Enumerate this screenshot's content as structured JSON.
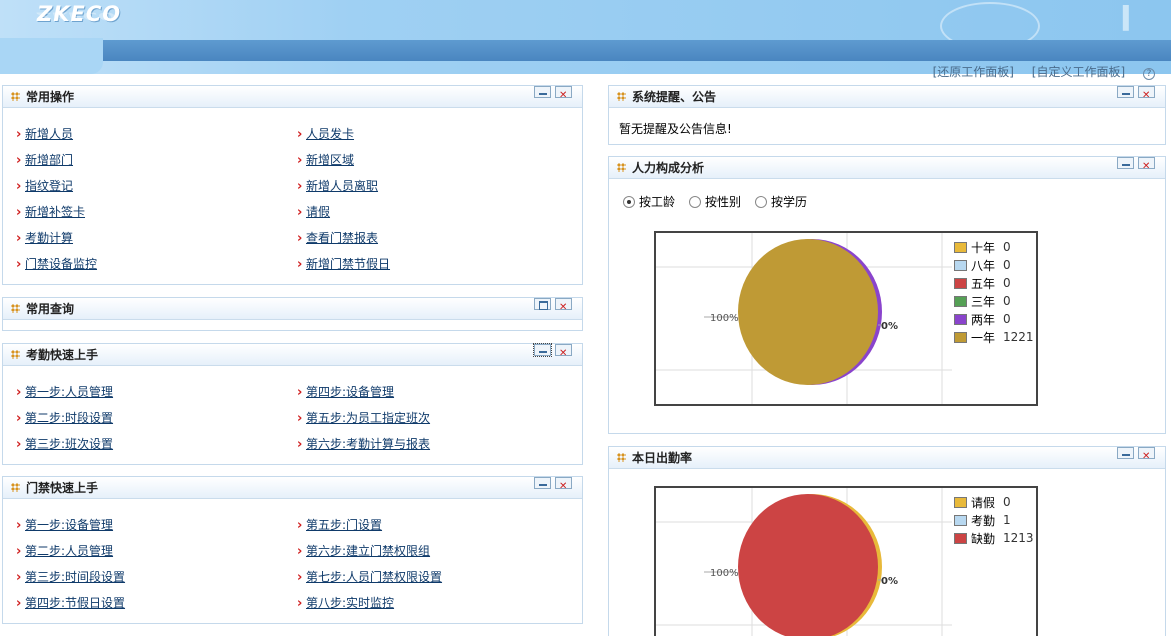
{
  "header": {
    "logo": "ZKECO",
    "restore_label": "[还原工作面板]",
    "customize_label": "[自定义工作面板]",
    "help": "?"
  },
  "common_ops": {
    "title": "常用操作",
    "left": [
      "新增人员",
      "新增部门",
      "指纹登记",
      "新增补签卡",
      "考勤计算",
      "门禁设备监控"
    ],
    "right": [
      "人员发卡",
      "新增区域",
      "新增人员离职",
      "请假",
      "查看门禁报表",
      "新增门禁节假日"
    ]
  },
  "common_query": {
    "title": "常用查询"
  },
  "att_quick": {
    "title": "考勤快速上手",
    "left": [
      "第一步:人员管理",
      "第二步:时段设置",
      "第三步:班次设置"
    ],
    "right": [
      "第四步:设备管理",
      "第五步:为员工指定班次",
      "第六步:考勤计算与报表"
    ]
  },
  "acc_quick": {
    "title": "门禁快速上手",
    "left": [
      "第一步:设备管理",
      "第二步:人员管理",
      "第三步:时间段设置",
      "第四步:节假日设置"
    ],
    "right": [
      "第五步:门设置",
      "第六步:建立门禁权限组",
      "第七步:人员门禁权限设置",
      "第八步:实时监控"
    ]
  },
  "notice": {
    "title": "系统提醒、公告",
    "text": "暂无提醒及公告信息!"
  },
  "hr": {
    "title": "人力构成分析",
    "radios": [
      "按工龄",
      "按性别",
      "按学历"
    ],
    "selected": 0
  },
  "attendance": {
    "title": "本日出勤率"
  },
  "chart_data": [
    {
      "type": "pie",
      "title": "",
      "series": [
        {
          "name": "十年",
          "value": 0,
          "color": "#e8b93a"
        },
        {
          "name": "八年",
          "value": 0,
          "color": "#b8d8f0"
        },
        {
          "name": "五年",
          "value": 0,
          "color": "#cc4444"
        },
        {
          "name": "三年",
          "value": 0,
          "color": "#55a055"
        },
        {
          "name": "两年",
          "value": 0,
          "color": "#8a44cc"
        },
        {
          "name": "一年",
          "value": 1221,
          "color": "#bf9a35"
        }
      ],
      "labels": {
        "main": "100%",
        "side": "0%"
      }
    },
    {
      "type": "pie",
      "title": "",
      "series": [
        {
          "name": "请假",
          "value": 0,
          "color": "#e8b93a"
        },
        {
          "name": "考勤",
          "value": 1,
          "color": "#b8d8f0"
        },
        {
          "name": "缺勤",
          "value": 1213,
          "color": "#cc4444"
        }
      ],
      "labels": {
        "main": "100%",
        "side": "0%"
      }
    }
  ]
}
